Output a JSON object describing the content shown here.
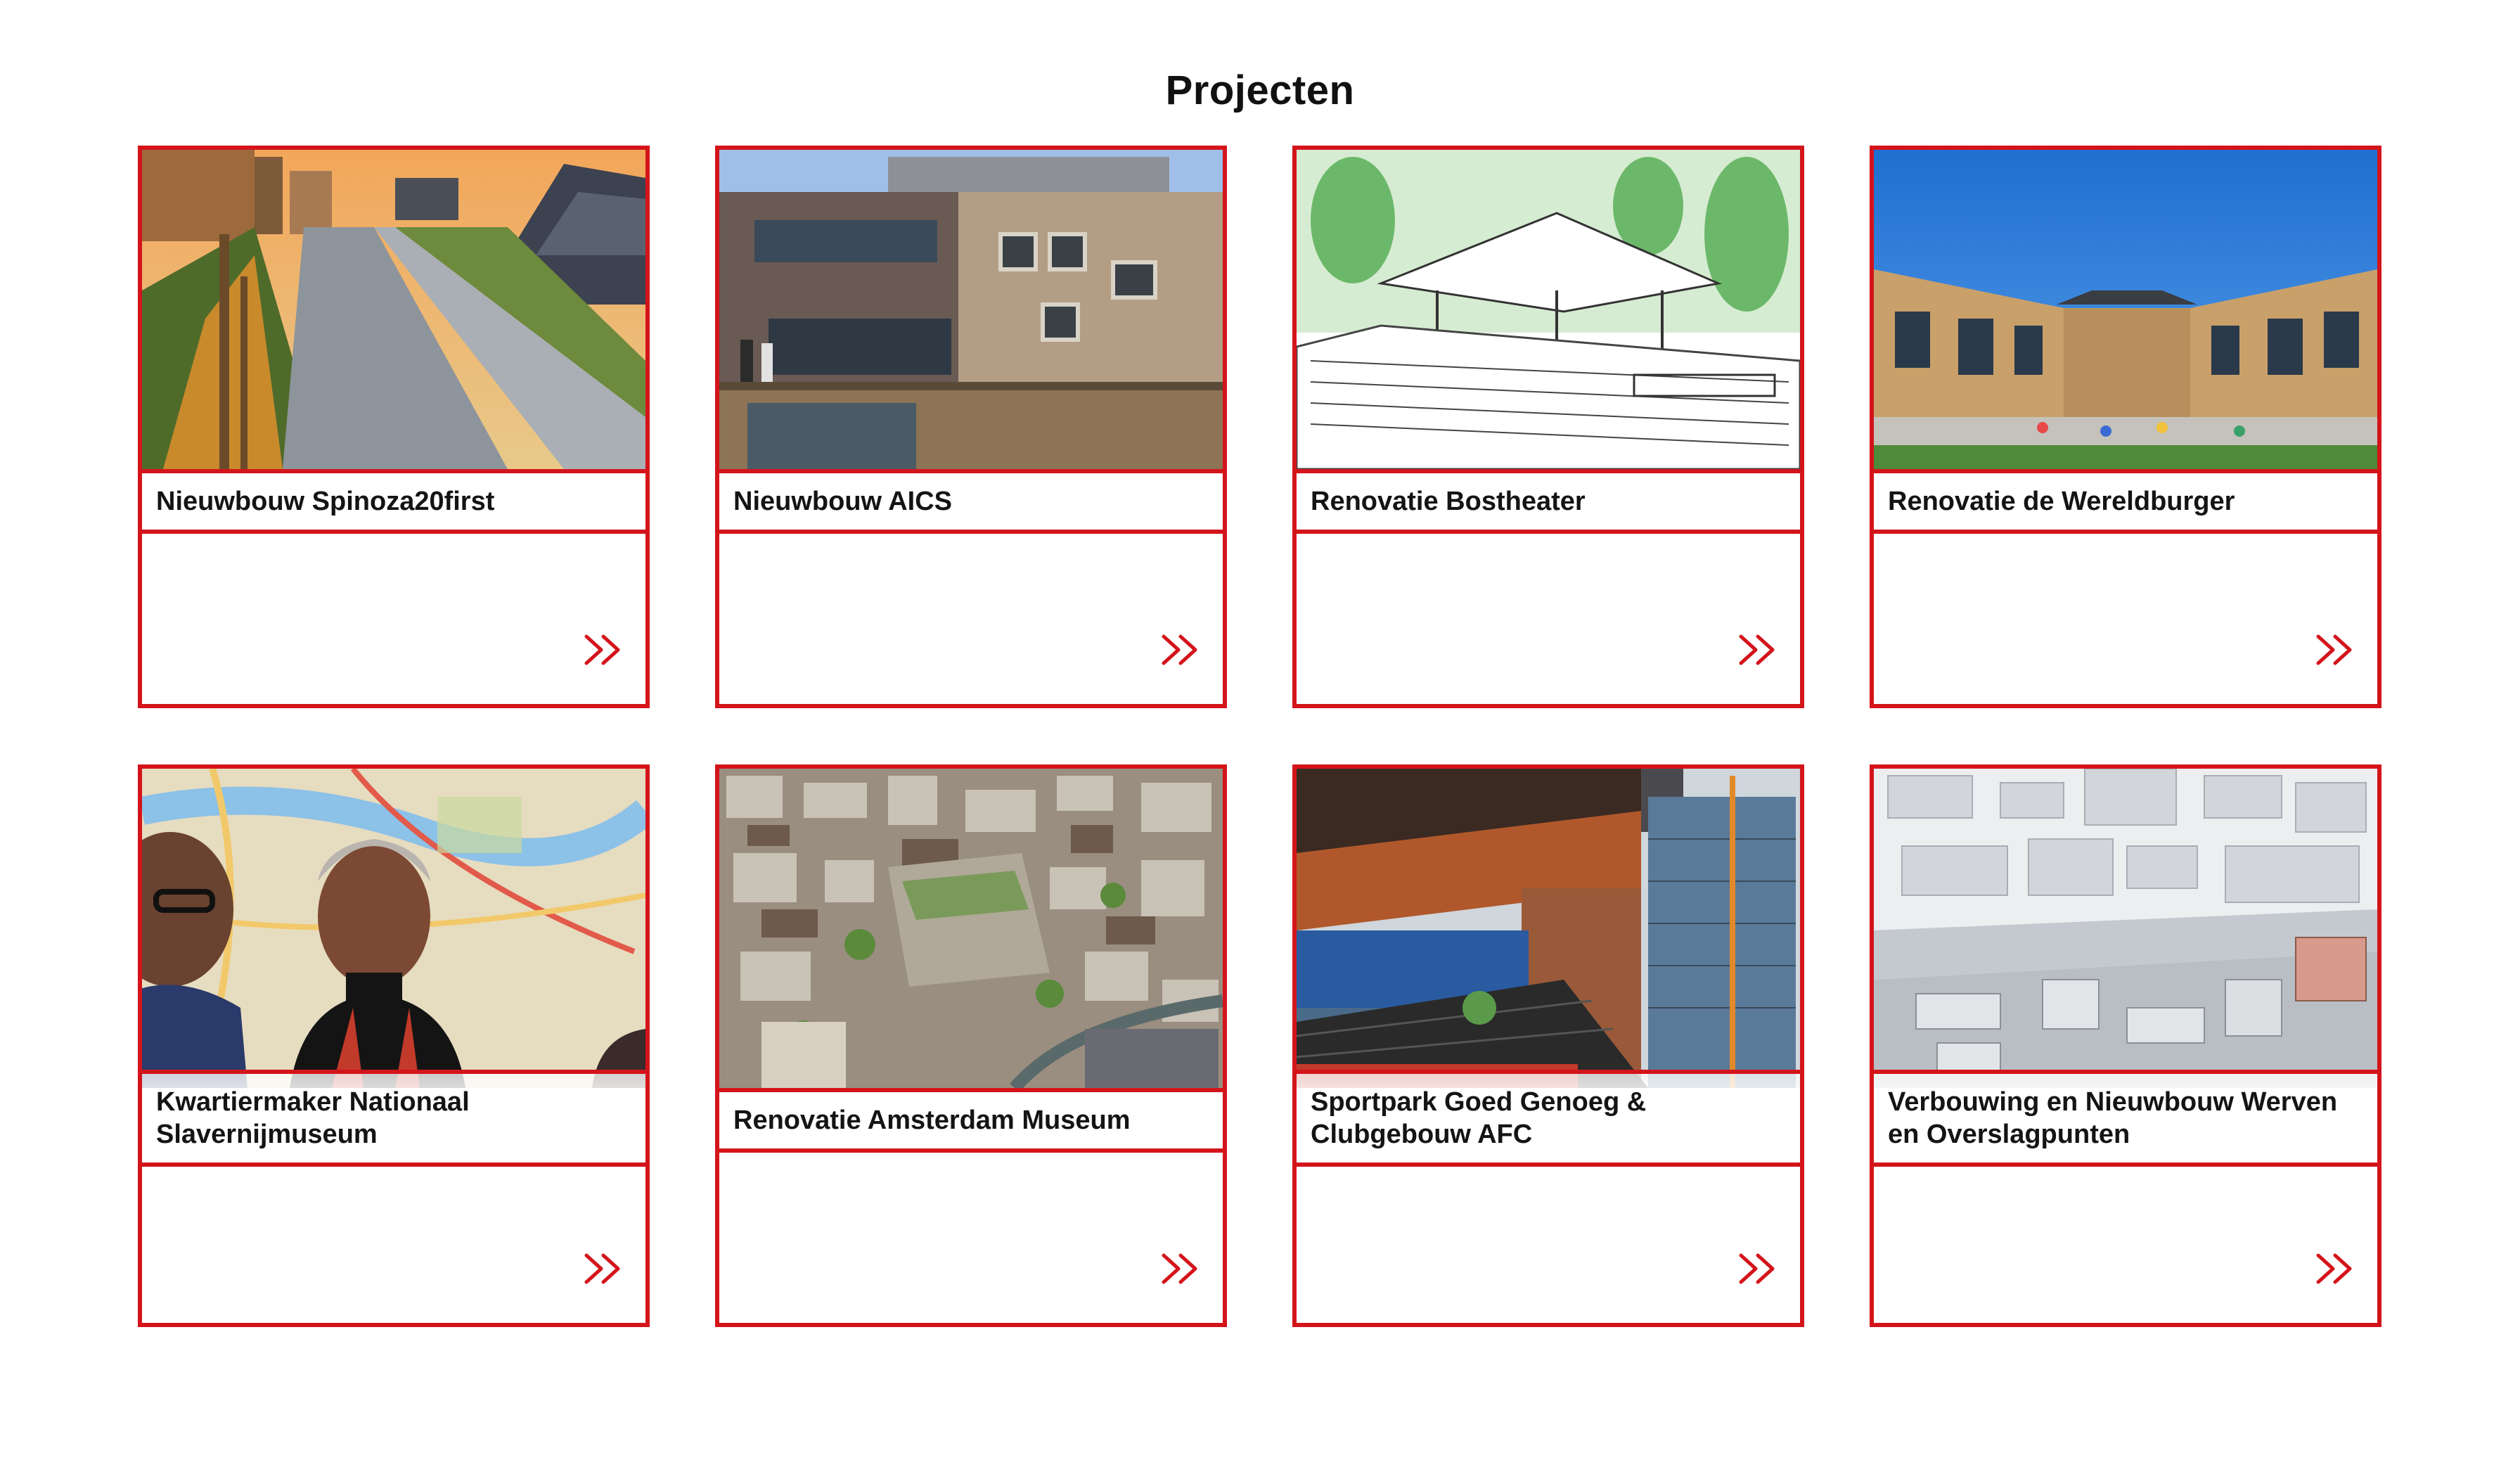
{
  "page": {
    "title": "Projecten"
  },
  "colors": {
    "accent": "#d4141b",
    "text": "#141414",
    "background": "#ffffff"
  },
  "projects": [
    {
      "title": "Nieuwbouw Spinoza20first",
      "image": "rooftop-garden-photo",
      "icon": "double-chevron-right-icon"
    },
    {
      "title": "Nieuwbouw AICS",
      "image": "school-building-photo",
      "icon": "double-chevron-right-icon"
    },
    {
      "title": "Renovatie Bostheater",
      "image": "theater-sketch-illustration",
      "icon": "double-chevron-right-icon"
    },
    {
      "title": "Renovatie de Wereldburger",
      "image": "school-courtyard-photo",
      "icon": "double-chevron-right-icon"
    },
    {
      "title": "Kwartiermaker Nationaal Slavernijmuseum",
      "image": "portrait-over-map-photo",
      "icon": "double-chevron-right-icon"
    },
    {
      "title": "Renovatie Amsterdam Museum",
      "image": "aerial-city-photo",
      "icon": "double-chevron-right-icon"
    },
    {
      "title": "Sportpark Goed Genoeg & Clubgebouw AFC",
      "image": "stadium-towers-photo",
      "icon": "double-chevron-right-icon"
    },
    {
      "title": "Verbouwing en Nieuwbouw Werven en Overslagpunten",
      "image": "quay-model-render",
      "icon": "double-chevron-right-icon"
    }
  ]
}
